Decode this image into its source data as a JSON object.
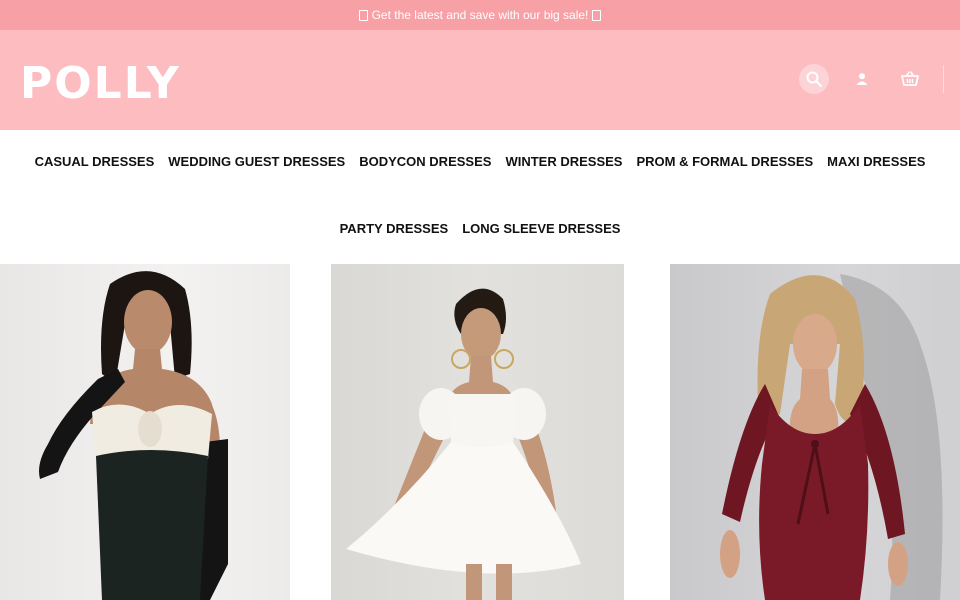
{
  "promo": {
    "text": "Get the latest and save with our big sale!"
  },
  "header": {
    "logo": "POLLY"
  },
  "icons": {
    "search": "search-icon",
    "account": "user-icon",
    "cart": "basket-icon"
  },
  "nav": {
    "row1": [
      "CASUAL DRESSES",
      "WEDDING GUEST DRESSES",
      "BODYCON DRESSES",
      "WINTER DRESSES",
      "PROM & FORMAL DRESSES",
      "MAXI DRESSES"
    ],
    "row2": [
      "PARTY DRESSES",
      "LONG SLEEVE DRESSES"
    ]
  },
  "products": [
    {
      "name": "black-white-bow-strapless-dress"
    },
    {
      "name": "white-puff-sleeve-mini-dress"
    },
    {
      "name": "burgundy-long-sleeve-tie-dress"
    }
  ],
  "colors": {
    "promo_bg": "#f7a1a6",
    "header_bg": "#fdbcc0",
    "text": "#111111"
  }
}
